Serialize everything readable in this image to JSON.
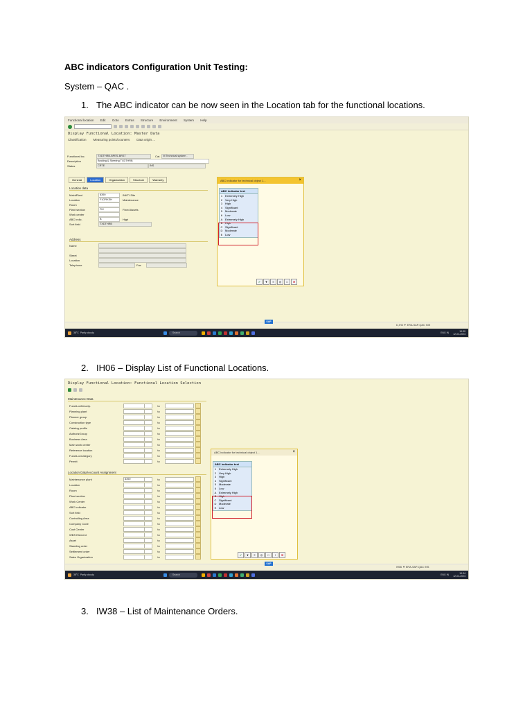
{
  "document": {
    "title": "ABC indicators Configuration Unit Testing:",
    "system_line": "System – QAC .",
    "steps": [
      {
        "number": "1.",
        "text": "The ABC indicator can be now seen in the Location tab for the functional locations."
      },
      {
        "number": "2.",
        "text": "IH06 – Display List of Functional Locations."
      },
      {
        "number": "3.",
        "text": "IW38 – List of Maintenance Orders."
      }
    ]
  },
  "shot1": {
    "menu": [
      "Functional location",
      "Edit",
      "Goto",
      "Extras",
      "Structure",
      "Environment",
      "System",
      "Help"
    ],
    "title": "Display Functional Location: Master Data",
    "app_toolbar": [
      "Classification",
      "Measuring points/counters",
      "Data origin ..."
    ],
    "header": [
      {
        "label": "Functional loc.",
        "value": "TXDTHRB-BPES-BRST"
      },
      {
        "label": "Description",
        "value": "Braking & Steering TXDTHRB"
      },
      {
        "label": "Status",
        "value": "CRTE"
      }
    ],
    "header_extra": {
      "cat_label": "Cat.",
      "cat_value": "M Technical system .",
      "status2": "INS"
    },
    "tabs": [
      "General",
      "Location",
      "Organization",
      "Structure",
      "Warranty"
    ],
    "location_section": "Location data",
    "location_rows": [
      {
        "label": "MaintPlant",
        "value": "8390",
        "desc": "INKTI Site"
      },
      {
        "label": "Location",
        "value": "F1ORKSH",
        "desc": "Maintenance"
      },
      {
        "label": "Room",
        "value": "",
        "desc": ""
      },
      {
        "label": "Plant section",
        "value": "FIX",
        "desc": "Fixed Assets"
      },
      {
        "label": "Work center",
        "value": "",
        "desc": ""
      },
      {
        "label": "ABC indic.",
        "value": "B",
        "desc": "High"
      },
      {
        "label": "Sort field",
        "value": "TXDTHRB",
        "desc": ""
      }
    ],
    "address_section": "Address",
    "address_rows": [
      "Name",
      "",
      "Street",
      "Location",
      "Telephone"
    ],
    "fax_label": "Fax",
    "popup_title": "ABC indicator for technical object 1...",
    "list_header": "ABC indicator text",
    "list_group1": [
      {
        "key": "1",
        "text": "Extremely High"
      },
      {
        "key": "2",
        "text": "Very High"
      },
      {
        "key": "3",
        "text": "High"
      },
      {
        "key": "4",
        "text": "Significant"
      },
      {
        "key": "5",
        "text": "Moderate"
      },
      {
        "key": "6",
        "text": "Low"
      }
    ],
    "list_group2": [
      {
        "key": "A",
        "text": "Extremely High"
      },
      {
        "key": "B",
        "text": "High"
      },
      {
        "key": "C",
        "text": "Significant"
      },
      {
        "key": "D",
        "text": "Moderate"
      },
      {
        "key": "E",
        "text": "Low"
      }
    ],
    "status_system": "D,IH3 ▼ ERA-SAP-QAC  INS",
    "taskbar": {
      "weather_temp": "38°C",
      "weather_desc": "Partly cloudy",
      "search": "Search",
      "lang": "ENG IN",
      "time": "19:30",
      "date": "12-03-2024"
    }
  },
  "shot2": {
    "title": "Display Functional Location: Functional Location Selection",
    "section1": "Maintenance Data",
    "rows1": [
      {
        "label": "FunctLocDescrip.",
        "value": ""
      },
      {
        "label": "Planning plant",
        "value": ""
      },
      {
        "label": "Planner group",
        "value": ""
      },
      {
        "label": "Construction type",
        "value": ""
      },
      {
        "label": "Catalog profile",
        "value": ""
      },
      {
        "label": "AuthorizGroup",
        "value": ""
      },
      {
        "label": "Business Area",
        "value": ""
      },
      {
        "label": "Main work center",
        "value": ""
      },
      {
        "label": "Reference location",
        "value": ""
      },
      {
        "label": "FunctLocCategory",
        "value": ""
      },
      {
        "label": "Permit",
        "value": ""
      }
    ],
    "section2": "Location Data/Account Assignment",
    "rows2": [
      {
        "label": "Maintenance plant",
        "value": "8390"
      },
      {
        "label": "Location",
        "value": ""
      },
      {
        "label": "Room",
        "value": ""
      },
      {
        "label": "Plant section",
        "value": ""
      },
      {
        "label": "Work Center",
        "value": ""
      },
      {
        "label": "ABC indicator",
        "value": ""
      },
      {
        "label": "Sort field",
        "value": ""
      },
      {
        "label": "Controlling Area",
        "value": ""
      },
      {
        "label": "Company Code",
        "value": ""
      },
      {
        "label": "Cost Center",
        "value": ""
      },
      {
        "label": "WBS Element",
        "value": ""
      },
      {
        "label": "Asset",
        "value": ""
      },
      {
        "label": "Standing order",
        "value": ""
      },
      {
        "label": "Settlement order",
        "value": ""
      },
      {
        "label": "Sales Organization",
        "value": ""
      }
    ],
    "to_label": "to",
    "popup_title": "ABC indicator for technical object 1...",
    "list_header": "ABC indicator text",
    "list_group1": [
      {
        "key": "1",
        "text": "Extremely High"
      },
      {
        "key": "2",
        "text": "Very High"
      },
      {
        "key": "3",
        "text": "High"
      },
      {
        "key": "4",
        "text": "Significant"
      },
      {
        "key": "5",
        "text": "Moderate"
      },
      {
        "key": "6",
        "text": "Low"
      }
    ],
    "list_group2": [
      {
        "key": "A",
        "text": "Extremely High"
      },
      {
        "key": "B",
        "text": "High"
      },
      {
        "key": "C",
        "text": "Significant"
      },
      {
        "key": "D",
        "text": "Moderate"
      },
      {
        "key": "E",
        "text": "Low"
      }
    ],
    "status_system": "IH06 ▼ ERA-SAP-QAC  INS",
    "taskbar": {
      "weather_temp": "38°C",
      "weather_desc": "Partly cloudy",
      "search": "Search",
      "lang": "ENG IN",
      "time": "19:34",
      "date": "12-03-2024"
    }
  }
}
